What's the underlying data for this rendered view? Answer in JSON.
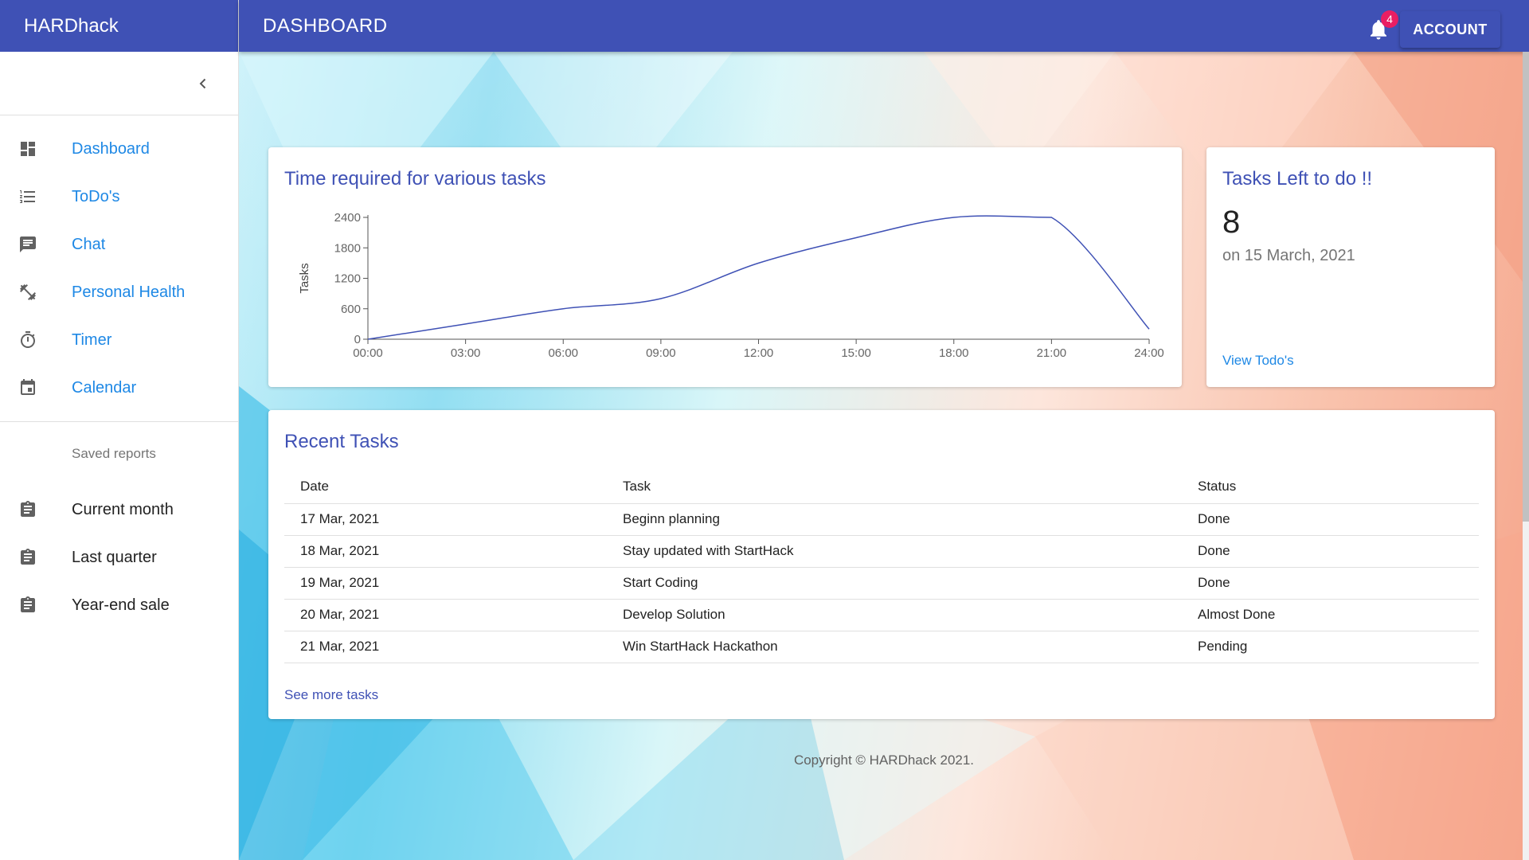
{
  "app": {
    "brand": "HARDhack",
    "page_title": "DASHBOARD"
  },
  "topbar": {
    "notification_count": "4",
    "account_label": "ACCOUNT"
  },
  "sidebar": {
    "items": [
      {
        "label": "Dashboard",
        "icon": "dashboard-icon"
      },
      {
        "label": "ToDo's",
        "icon": "list-icon"
      },
      {
        "label": "Chat",
        "icon": "chat-icon"
      },
      {
        "label": "Personal Health",
        "icon": "fitness-icon"
      },
      {
        "label": "Timer",
        "icon": "timer-icon"
      },
      {
        "label": "Calendar",
        "icon": "calendar-icon"
      }
    ],
    "saved_reports_header": "Saved reports",
    "reports": [
      {
        "label": "Current month",
        "icon": "clipboard-icon"
      },
      {
        "label": "Last quarter",
        "icon": "clipboard-icon"
      },
      {
        "label": "Year-end sale",
        "icon": "clipboard-icon"
      }
    ]
  },
  "chart_card": {
    "title": "Time required for various tasks"
  },
  "chart_data": {
    "type": "line",
    "title": "Time required for various tasks",
    "xlabel": "",
    "ylabel": "Tasks",
    "x": [
      "00:00",
      "03:00",
      "06:00",
      "09:00",
      "12:00",
      "15:00",
      "18:00",
      "21:00",
      "24:00"
    ],
    "series": [
      {
        "values": [
          0,
          300,
          600,
          800,
          1500,
          2000,
          2400,
          2400,
          null
        ]
      }
    ],
    "end_value": 200,
    "ylim": [
      0,
      2400
    ],
    "yticks": [
      0,
      600,
      1200,
      1800,
      2400
    ],
    "grid": false,
    "line_color": "#3f51b5"
  },
  "todo_card": {
    "title": "Tasks Left to do !!",
    "count": "8",
    "date": "on 15 March, 2021",
    "link": "View Todo's"
  },
  "tasks_card": {
    "title": "Recent Tasks",
    "columns": [
      "Date",
      "Task",
      "Status"
    ],
    "rows": [
      [
        "17 Mar, 2021",
        "Beginn planning",
        "Done"
      ],
      [
        "18 Mar, 2021",
        "Stay updated with StartHack",
        "Done"
      ],
      [
        "19 Mar, 2021",
        "Start Coding",
        "Done"
      ],
      [
        "20 Mar, 2021",
        "Develop Solution",
        "Almost Done"
      ],
      [
        "21 Mar, 2021",
        "Win StartHack Hackathon",
        "Pending"
      ]
    ],
    "link": "See more tasks"
  },
  "footer": {
    "copyright": "Copyright © HARDhack 2021."
  },
  "colors": {
    "primary": "#3f51b5",
    "link": "#1e88e5",
    "badge": "#e91e63"
  }
}
